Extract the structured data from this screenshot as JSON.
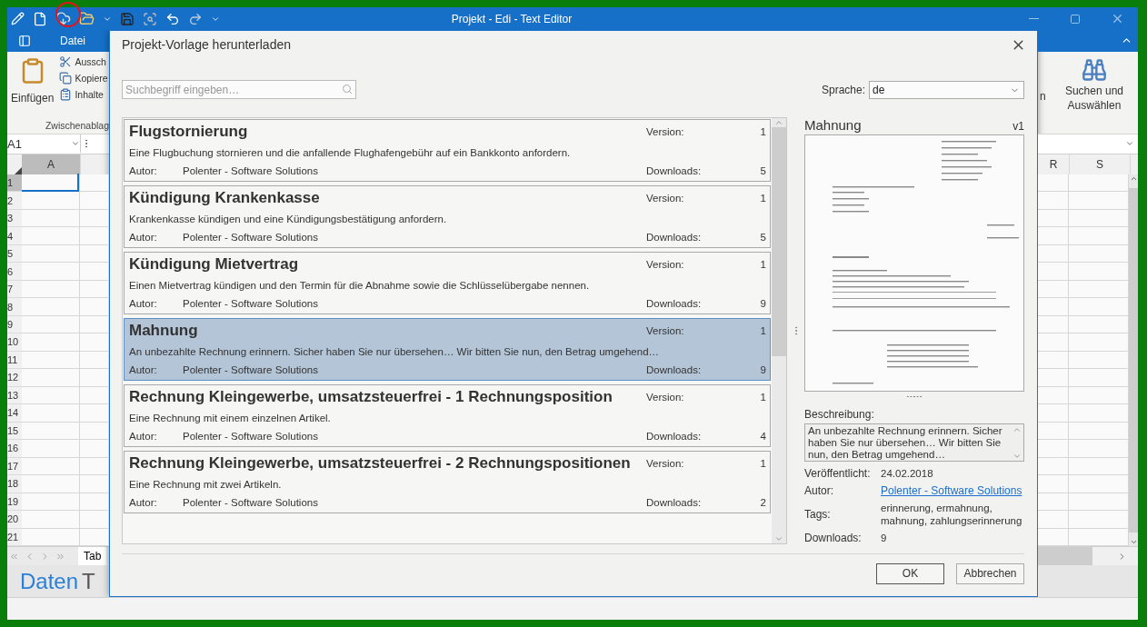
{
  "window": {
    "title": "Projekt - Edi - Text Editor"
  },
  "ribbon": {
    "tab": "Datei",
    "paste_label": "Einfügen",
    "clipboard_items": [
      {
        "kind": "cut",
        "label": "Aussch"
      },
      {
        "kind": "copy",
        "label": "Kopiere"
      },
      {
        "kind": "paste-special",
        "label": "Inhalte"
      }
    ],
    "group_label": "Zwischenablag",
    "cut_off_label": "n",
    "find_lines": [
      "Suchen und",
      "Auswählen"
    ]
  },
  "sheet": {
    "name_box": "A1",
    "left_columns": [
      {
        "label": "A",
        "selected": true
      }
    ],
    "right_columns": [
      {
        "label": "R",
        "selected": false
      },
      {
        "label": "S",
        "selected": false
      }
    ],
    "rows": [
      {
        "label": "1",
        "selected": true
      },
      {
        "label": "2",
        "selected": false
      },
      {
        "label": "3",
        "selected": false
      },
      {
        "label": "4",
        "selected": false
      },
      {
        "label": "5",
        "selected": false
      },
      {
        "label": "6",
        "selected": false
      },
      {
        "label": "7",
        "selected": false
      },
      {
        "label": "8",
        "selected": false
      },
      {
        "label": "9",
        "selected": false
      },
      {
        "label": "10",
        "selected": false
      },
      {
        "label": "11",
        "selected": false
      },
      {
        "label": "12",
        "selected": false
      },
      {
        "label": "13",
        "selected": false
      },
      {
        "label": "14",
        "selected": false
      },
      {
        "label": "15",
        "selected": false
      },
      {
        "label": "16",
        "selected": false
      },
      {
        "label": "17",
        "selected": false
      },
      {
        "label": "18",
        "selected": false
      },
      {
        "label": "19",
        "selected": false
      },
      {
        "label": "20",
        "selected": false
      },
      {
        "label": "21",
        "selected": false
      }
    ],
    "sheet_tab": "Tab"
  },
  "caption": {
    "word": "Daten",
    "next": "T"
  },
  "dialog": {
    "title": "Projekt-Vorlage herunterladen",
    "search": {
      "placeholder": "Suchbegriff eingeben…"
    },
    "language_label": "Sprache:",
    "language": "de",
    "templates": [
      {
        "title": "Flugstornierung",
        "version_label": "Version:",
        "version": "1",
        "description": "Eine Flugbuchung stornieren und die anfallende Flughafengebühr auf ein Bankkonto anfordern.",
        "author_label": "Autor:",
        "author": "Polenter - Software Solutions",
        "downloads_label": "Downloads:",
        "downloads": "5",
        "selected": false
      },
      {
        "title": "Kündigung Krankenkasse",
        "version_label": "Version:",
        "version": "1",
        "description": "Krankenkasse kündigen und eine Kündigungsbestätigung anfordern.",
        "author_label": "Autor:",
        "author": "Polenter - Software Solutions",
        "downloads_label": "Downloads:",
        "downloads": "5",
        "selected": false
      },
      {
        "title": "Kündigung Mietvertrag",
        "version_label": "Version:",
        "version": "1",
        "description": "Einen Mietvertrag kündigen und den Termin für die Abnahme sowie die Schlüsselübergabe nennen.",
        "author_label": "Autor:",
        "author": "Polenter - Software Solutions",
        "downloads_label": "Downloads:",
        "downloads": "9",
        "selected": false
      },
      {
        "title": "Mahnung",
        "version_label": "Version:",
        "version": "1",
        "description": "An unbezahlte Rechnung erinnern. Sicher haben Sie nur übersehen… Wir bitten Sie nun, den Betrag umgehend…",
        "author_label": "Autor:",
        "author": "Polenter - Software Solutions",
        "downloads_label": "Downloads:",
        "downloads": "9",
        "selected": true
      },
      {
        "title": "Rechnung Kleingewerbe, umsatzsteuerfrei - 1 Rechnungsposition",
        "version_label": "Version:",
        "version": "1",
        "description": "Eine Rechnung mit einem einzelnen Artikel.",
        "author_label": "Autor:",
        "author": "Polenter - Software Solutions",
        "downloads_label": "Downloads:",
        "downloads": "4",
        "selected": false
      },
      {
        "title": "Rechnung Kleingewerbe, umsatzsteuerfrei - 2 Rechnungspositionen",
        "version_label": "Version:",
        "version": "1",
        "description": "Eine Rechnung mit zwei Artikeln.",
        "author_label": "Autor:",
        "author": "Polenter - Software Solutions",
        "downloads_label": "Downloads:",
        "downloads": "2",
        "selected": false
      }
    ],
    "detail": {
      "title": "Mahnung",
      "version": "v1",
      "description_label": "Beschreibung:",
      "description": "An unbezahlte Rechnung erinnern. Sicher haben Sie nur übersehen… Wir bitten Sie nun, den Betrag umgehend…",
      "fields": [
        {
          "kind": "text",
          "label": "Veröffentlicht:",
          "value": "24.02.2018"
        },
        {
          "kind": "link",
          "label": "Autor:",
          "value": "Polenter - Software Solutions"
        },
        {
          "kind": "text",
          "label": "Tags:",
          "value": "erinnerung, ermahnung, mahnung, zahlungserinnerung"
        },
        {
          "kind": "text",
          "label": "Downloads:",
          "value": "9"
        }
      ]
    },
    "buttons": [
      "OK",
      "Abbrechen"
    ]
  }
}
